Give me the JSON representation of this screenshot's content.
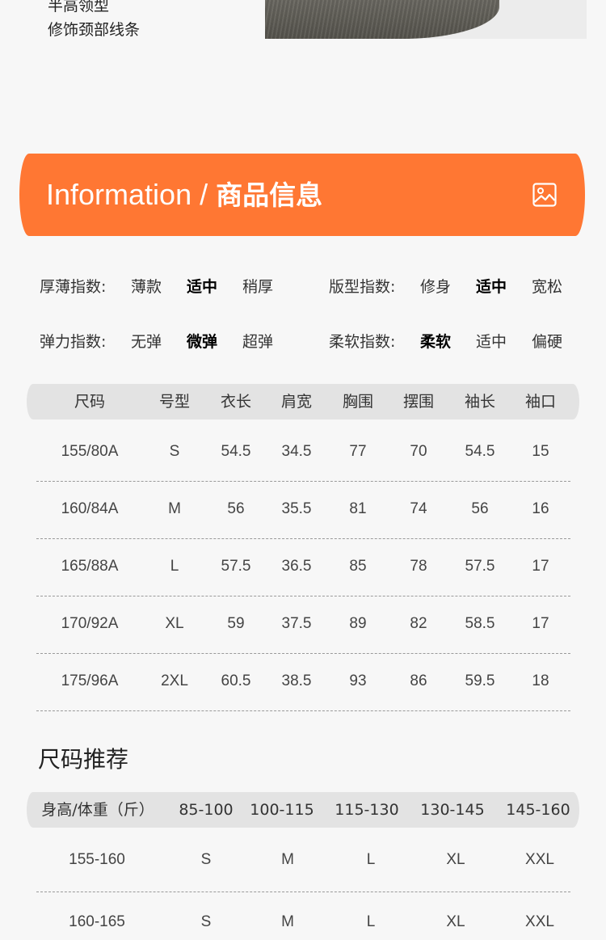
{
  "intro": {
    "line1": "半高领型",
    "line2": "修饰颈部线条"
  },
  "banner": {
    "title_en": "Information",
    "title_sep": " / ",
    "title_cn": "商品信息",
    "icon": "image-icon",
    "color": "#ff7733"
  },
  "indices": [
    {
      "label": "厚薄指数:",
      "options": [
        "薄款",
        "适中",
        "稍厚"
      ],
      "selected": 1
    },
    {
      "label": "版型指数:",
      "options": [
        "修身",
        "适中",
        "宽松"
      ],
      "selected": 1
    },
    {
      "label": "弹力指数:",
      "options": [
        "无弹",
        "微弹",
        "超弹"
      ],
      "selected": 1
    },
    {
      "label": "柔软指数:",
      "options": [
        "柔软",
        "适中",
        "偏硬"
      ],
      "selected": 0
    }
  ],
  "size_table": {
    "headers": [
      "尺码",
      "号型",
      "衣长",
      "肩宽",
      "胸围",
      "摆围",
      "袖长",
      "袖口"
    ],
    "rows": [
      [
        "155/80A",
        "S",
        "54.5",
        "34.5",
        "77",
        "70",
        "54.5",
        "15"
      ],
      [
        "160/84A",
        "M",
        "56",
        "35.5",
        "81",
        "74",
        "56",
        "16"
      ],
      [
        "165/88A",
        "L",
        "57.5",
        "36.5",
        "85",
        "78",
        "57.5",
        "17"
      ],
      [
        "170/92A",
        "XL",
        "59",
        "37.5",
        "89",
        "82",
        "58.5",
        "17"
      ],
      [
        "175/96A",
        "2XL",
        "60.5",
        "38.5",
        "93",
        "86",
        "59.5",
        "18"
      ]
    ]
  },
  "recommend": {
    "title": "尺码推荐",
    "headers": [
      "身高/体重（斤）",
      "85-100",
      "100-115",
      "115-130",
      "130-145",
      "145-160"
    ],
    "rows": [
      [
        "155-160",
        "S",
        "M",
        "L",
        "XL",
        "XXL"
      ],
      [
        "160-165",
        "S",
        "M",
        "L",
        "XL",
        "XXL"
      ]
    ]
  }
}
